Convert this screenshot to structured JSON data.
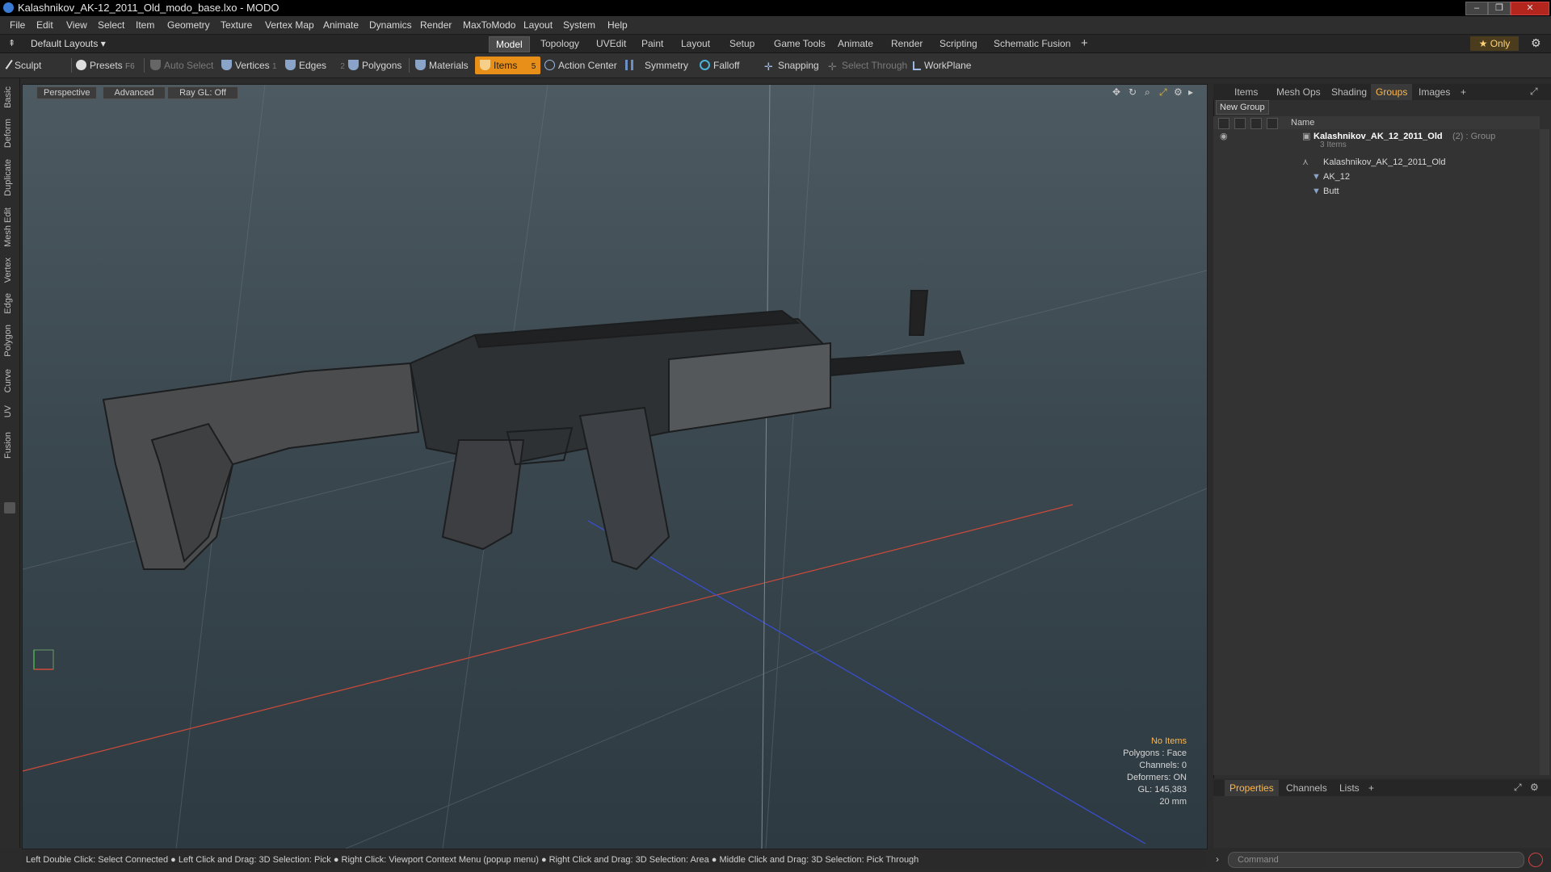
{
  "window": {
    "title": "Kalashnikov_AK-12_2011_Old_modo_base.lxo - MODO",
    "buttons": [
      "–",
      "❐",
      "✕"
    ]
  },
  "menu": [
    "File",
    "Edit",
    "View",
    "Select",
    "Item",
    "Geometry",
    "Texture",
    "Vertex Map",
    "Animate",
    "Dynamics",
    "Render",
    "MaxToModo",
    "Layout",
    "System",
    "Help"
  ],
  "layouts": {
    "dropdown": "Default Layouts",
    "tabs": [
      "Model",
      "Topology",
      "UVEdit",
      "Paint",
      "Layout",
      "Setup",
      "Game Tools",
      "Animate",
      "Render",
      "Scripting",
      "Schematic Fusion"
    ],
    "active": "Model",
    "plus": "+",
    "only": "★ Only"
  },
  "toolbar": {
    "sculpt": "Sculpt",
    "presets": "Presets",
    "presets_key": "F6",
    "auto_select": "Auto Select",
    "vertices": "Vertices",
    "vertices_n": "1",
    "edges": "Edges",
    "edges_n": "2",
    "polygons": "Polygons",
    "materials": "Materials",
    "items": "Items",
    "items_n": "5",
    "action_center": "Action Center",
    "symmetry": "Symmetry",
    "falloff": "Falloff",
    "snapping": "Snapping",
    "select_through": "Select Through",
    "workplane": "WorkPlane"
  },
  "left_strip": [
    "Basic",
    "Deform",
    "Duplicate",
    "Mesh Edit",
    "Vertex",
    "Edge",
    "Polygon",
    "Curve",
    "UV",
    "Fusion"
  ],
  "viewport": {
    "view": "Perspective",
    "shading": "Advanced",
    "raygl": "Ray GL: Off",
    "stats": {
      "items": "No Items",
      "polygons": "Polygons : Face",
      "channels": "Channels: 0",
      "deformers": "Deformers: ON",
      "gl": "GL: 145,383",
      "scale": "20 mm"
    }
  },
  "statusbar": "Left Double Click: Select Connected ● Left Click and Drag: 3D Selection: Pick ● Right Click: Viewport Context Menu (popup menu) ● Right Click and Drag: 3D Selection: Area ● Middle Click and Drag: 3D Selection: Pick Through",
  "right_panel": {
    "tabs": [
      "Items",
      "Mesh Ops",
      "Shading",
      "Groups",
      "Images"
    ],
    "active": "Groups",
    "plus": "+",
    "new_group": "New Group",
    "column": "Name",
    "tree": {
      "root": "Kalashnikov_AK_12_2011_Old",
      "root_suffix": "(2) : Group",
      "root_count": "3 Items",
      "children": [
        "Kalashnikov_AK_12_2011_Old",
        "AK_12",
        "Butt"
      ]
    }
  },
  "bottom_panel": {
    "tabs": [
      "Properties",
      "Channels",
      "Lists"
    ],
    "active": "Properties",
    "plus": "+",
    "command_placeholder": "Command"
  },
  "colors": {
    "accent": "#e88f1a",
    "tab_active_text": "#ffb74a",
    "x_axis": "#c0392b",
    "z_axis": "#3a4fd8"
  }
}
